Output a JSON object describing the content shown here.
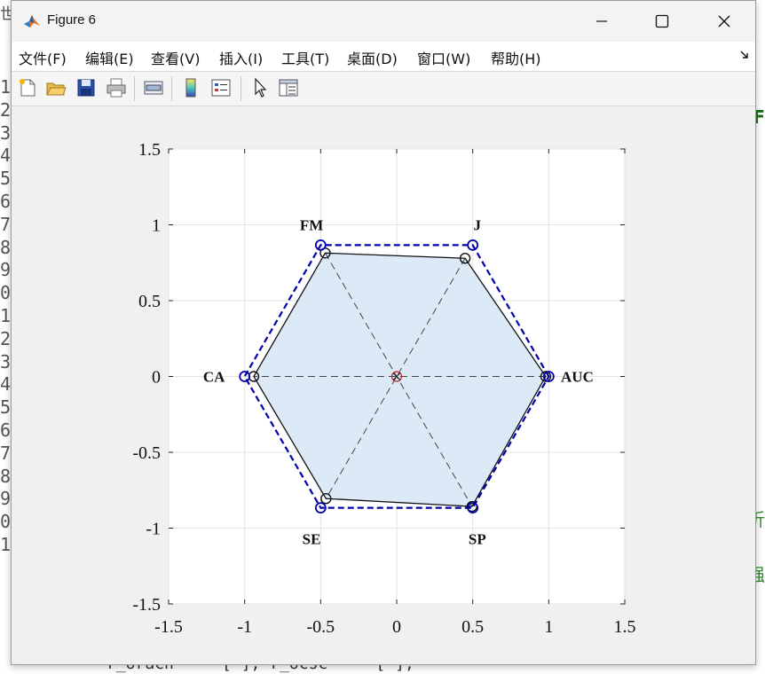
{
  "window": {
    "title": "Figure 6"
  },
  "menu": {
    "items": [
      "文件(F)",
      "编辑(E)",
      "查看(V)",
      "插入(I)",
      "工具(T)",
      "桌面(D)",
      "窗口(W)",
      "帮助(H)"
    ]
  },
  "toolbar": {
    "buttons": [
      "new-figure-icon",
      "open-file-icon",
      "save-icon",
      "print-icon",
      "link-icon",
      "colorbar-icon",
      "legend-icon",
      "pointer-icon",
      "property-inspector-icon"
    ]
  },
  "background": {
    "gutter_digits": [
      "1",
      "2",
      "3",
      "4",
      "5",
      "6",
      "7",
      "8",
      "9",
      "0",
      "1",
      "2",
      "3",
      "4",
      "5",
      "6",
      "7",
      "8",
      "9",
      "0",
      "1"
    ],
    "right_chars": [
      "F",
      "折",
      "强"
    ],
    "top_left_char": "世"
  },
  "colors": {
    "fill": "#dce9f7",
    "dashed_outer": "#0000aa",
    "solid_inner": "#111111",
    "spokes": "#444444",
    "center_marker": "#cc2222"
  },
  "chart_data": {
    "type": "radar",
    "xlim": [
      -1.5,
      1.5
    ],
    "ylim": [
      -1.5,
      1.5
    ],
    "xticks": [
      "-1.5",
      "-1",
      "-0.5",
      "0",
      "0.5",
      "1",
      "1.5"
    ],
    "yticks": [
      "1.5",
      "1",
      "0.5",
      "0",
      "-0.5",
      "-1",
      "-1.5"
    ],
    "grid": true,
    "axes": [
      "AUC",
      "J",
      "FM",
      "CA",
      "SE",
      "SP"
    ],
    "angles_deg": [
      0,
      60,
      120,
      180,
      240,
      300
    ],
    "reference_radius": 1.0,
    "values": [
      0.98,
      0.9,
      0.94,
      0.94,
      0.93,
      0.99
    ]
  }
}
